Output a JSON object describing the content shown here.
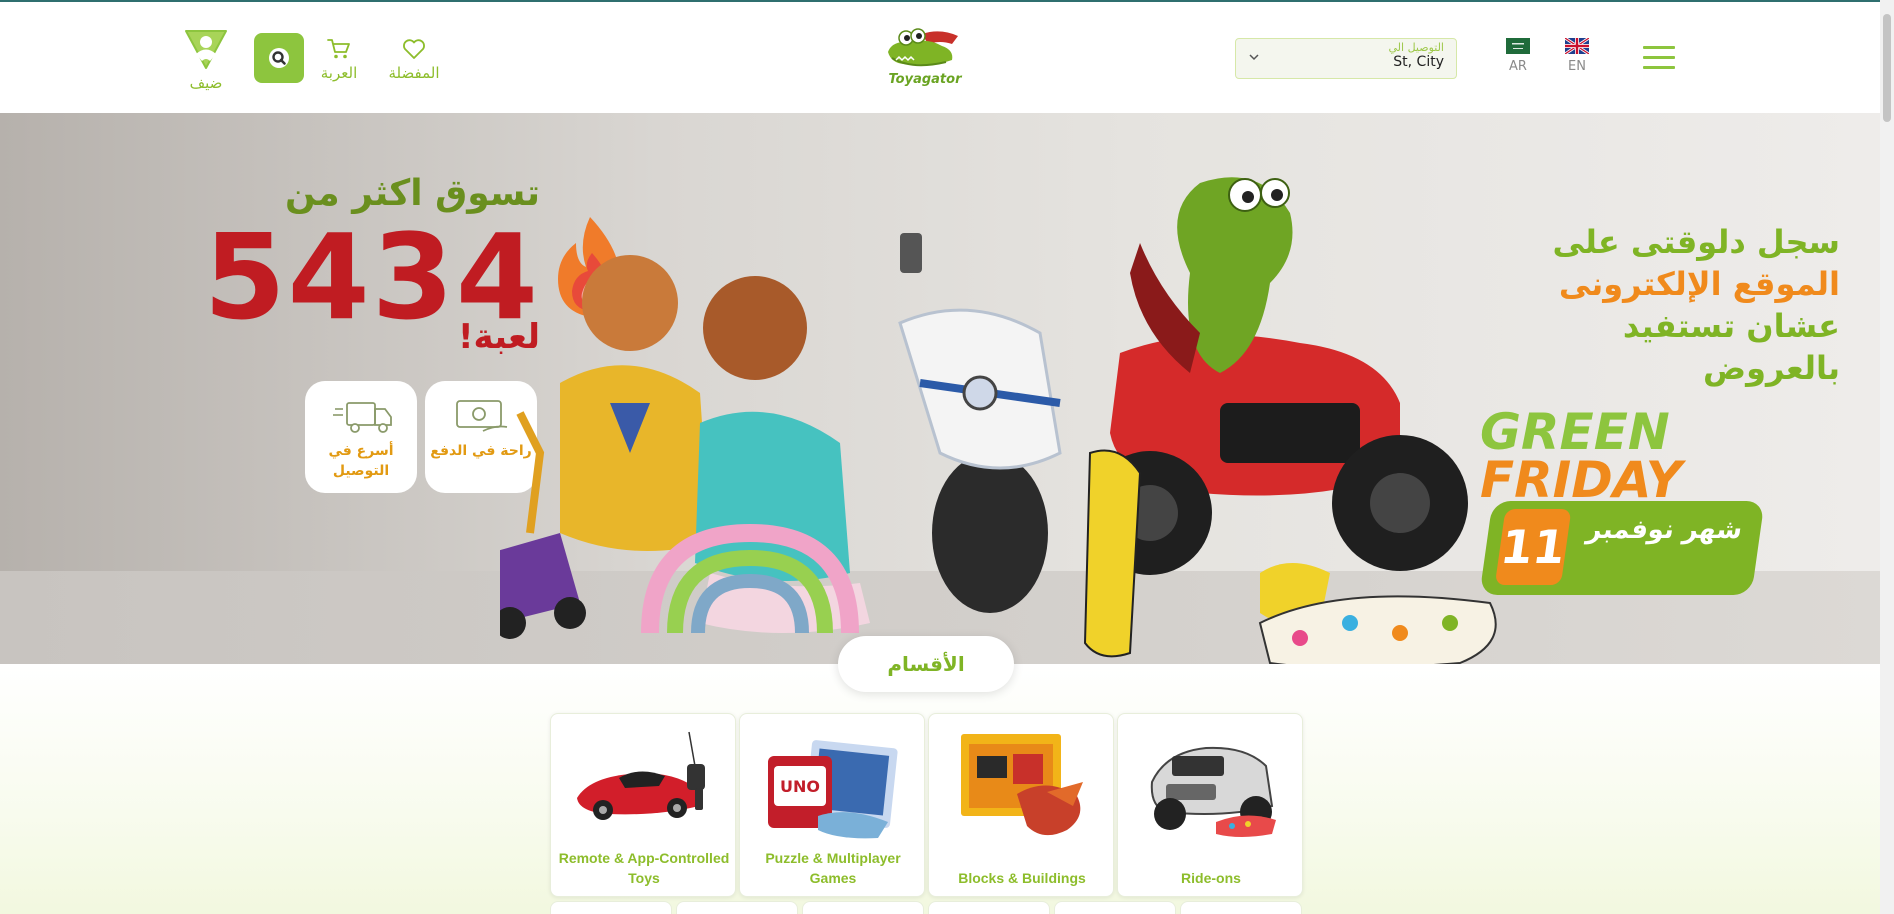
{
  "header": {
    "guest_label": "ضيف",
    "cart_label": "العربة",
    "favorites_label": "المفضلة",
    "logo_text": "Toyagator",
    "delivery": {
      "label": "التوصيل الي",
      "value": "St, City"
    },
    "languages": [
      {
        "code": "AR"
      },
      {
        "code": "EN"
      }
    ]
  },
  "banner": {
    "shop_line": "تسوق اكثر من",
    "toy_count": "5434",
    "toys_word": "لعبة!",
    "features": [
      {
        "label": "راحة في الدفع"
      },
      {
        "label": "أسرع في التوصيل"
      }
    ],
    "promo_lines": [
      "سجل دلوقتى على",
      "الموقع الإلكترونى",
      "عشان تستفيد",
      "بالعروض"
    ],
    "green": "GREEN",
    "friday": "FRIDAY",
    "month_number": "11",
    "month_text": "شهر نوفمبر"
  },
  "categories": {
    "title": "الأقسام",
    "items": [
      {
        "label": "Remote & App-Controlled Toys"
      },
      {
        "label": "Puzzle & Multiplayer Games"
      },
      {
        "label": "Blocks & Buildings"
      },
      {
        "label": "Ride-ons"
      }
    ]
  },
  "colors": {
    "brand_green": "#8dc53e",
    "accent_orange": "#f08a1c",
    "accent_red": "#c01c22"
  }
}
